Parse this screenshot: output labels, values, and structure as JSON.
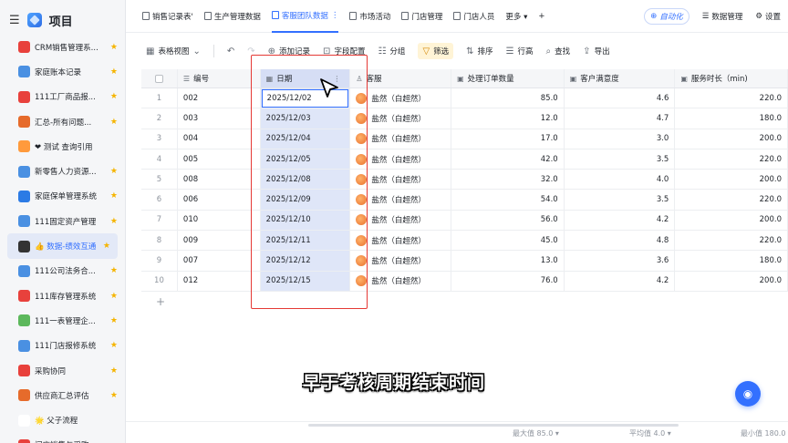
{
  "sidebar": {
    "title": "项目",
    "items": [
      {
        "label": "CRM销售管理系...",
        "icon_color": "#e8413c",
        "star": true
      },
      {
        "label": "家庭账本记录",
        "icon_color": "#4a90e2",
        "star": true
      },
      {
        "label": "111工厂商品报...",
        "icon_color": "#e8413c",
        "star": true
      },
      {
        "label": "汇总-所有问题...",
        "icon_color": "#e66b2b",
        "star": true
      },
      {
        "label": "❤ 测试 查询引用",
        "icon_color": "#ff9a3c",
        "star": false
      },
      {
        "label": "新零售人力资源...",
        "icon_color": "#4a90e2",
        "star": true
      },
      {
        "label": "家庭保单管理系统",
        "icon_color": "#2c7be5",
        "star": true
      },
      {
        "label": "111固定资产管理",
        "icon_color": "#4a90e2",
        "star": true
      },
      {
        "label": "👍 数据-绩效互通",
        "icon_color": "#333333",
        "star": true,
        "active": true
      },
      {
        "label": "111公司法务合...",
        "icon_color": "#4a90e2",
        "star": true
      },
      {
        "label": "111库存管理系统",
        "icon_color": "#e8413c",
        "star": true
      },
      {
        "label": "111一表管理企...",
        "icon_color": "#5cb85c",
        "star": true
      },
      {
        "label": "111门店报修系统",
        "icon_color": "#4a90e2",
        "star": true
      },
      {
        "label": "采购协同",
        "icon_color": "#e8413c",
        "star": true
      },
      {
        "label": "供应商汇总评估",
        "icon_color": "#e66b2b",
        "star": true
      },
      {
        "label": "🌟 父子流程",
        "icon_color": "#ffffff",
        "star": false
      },
      {
        "label": "门店销售与采购...",
        "icon_color": "#e8413c",
        "star": false
      }
    ]
  },
  "tabs": [
    {
      "label": "销售记录表'",
      "active": false
    },
    {
      "label": "生产管理数据",
      "active": false
    },
    {
      "label": "客服团队数据",
      "active": true
    },
    {
      "label": "市场活动",
      "active": false
    },
    {
      "label": "门店管理",
      "active": false
    },
    {
      "label": "门店人员",
      "active": false
    },
    {
      "label": "更多 ▾",
      "active": false
    },
    {
      "label": "+",
      "active": false
    }
  ],
  "topright": {
    "automation": "自动化",
    "data_manage": "数据管理",
    "settings": "设置"
  },
  "toolbar": {
    "view": "表格视图",
    "add_record": "添加记录",
    "field_config": "字段配置",
    "group": "分组",
    "filter": "筛选",
    "sort": "排序",
    "row_height": "行高",
    "search": "查找",
    "export": "导出"
  },
  "columns": {
    "number": "编号",
    "date": "日期",
    "agent": "客服",
    "orders": "处理订单数量",
    "satisfaction": "客户满意度",
    "duration": "服务时长（min)"
  },
  "rows": [
    {
      "idx": "1",
      "id": "002",
      "date": "2025/12/02",
      "agent": "盐然（白超然）",
      "orders": "85.0",
      "sat": "4.6",
      "dur": "220.0"
    },
    {
      "idx": "2",
      "id": "003",
      "date": "2025/12/03",
      "agent": "盐然（白超然）",
      "orders": "12.0",
      "sat": "4.7",
      "dur": "180.0"
    },
    {
      "idx": "3",
      "id": "004",
      "date": "2025/12/04",
      "agent": "盐然（白超然）",
      "orders": "17.0",
      "sat": "3.0",
      "dur": "200.0"
    },
    {
      "idx": "4",
      "id": "005",
      "date": "2025/12/05",
      "agent": "盐然（白超然）",
      "orders": "42.0",
      "sat": "3.5",
      "dur": "220.0"
    },
    {
      "idx": "5",
      "id": "008",
      "date": "2025/12/08",
      "agent": "盐然（白超然）",
      "orders": "32.0",
      "sat": "4.0",
      "dur": "200.0"
    },
    {
      "idx": "6",
      "id": "006",
      "date": "2025/12/09",
      "agent": "盐然（白超然）",
      "orders": "54.0",
      "sat": "3.5",
      "dur": "220.0"
    },
    {
      "idx": "7",
      "id": "010",
      "date": "2025/12/10",
      "agent": "盐然（白超然）",
      "orders": "56.0",
      "sat": "4.2",
      "dur": "200.0"
    },
    {
      "idx": "8",
      "id": "009",
      "date": "2025/12/11",
      "agent": "盐然（白超然）",
      "orders": "45.0",
      "sat": "4.8",
      "dur": "220.0"
    },
    {
      "idx": "9",
      "id": "007",
      "date": "2025/12/12",
      "agent": "盐然（白超然）",
      "orders": "13.0",
      "sat": "3.6",
      "dur": "180.0"
    },
    {
      "idx": "10",
      "id": "012",
      "date": "2025/12/15",
      "agent": "盐然（白超然）",
      "orders": "76.0",
      "sat": "4.2",
      "dur": "200.0"
    }
  ],
  "subtitle": "早于考核周期结束时间",
  "footer": {
    "max": "最大值 85.0 ▾",
    "avg": "平均值 4.0 ▾",
    "min": "最小值 180.0 ▾"
  },
  "colors": {
    "accent": "#3370ff",
    "highlight_box": "#e53935",
    "date_column_bg": "#dfe6f8",
    "star": "#f5b400"
  }
}
